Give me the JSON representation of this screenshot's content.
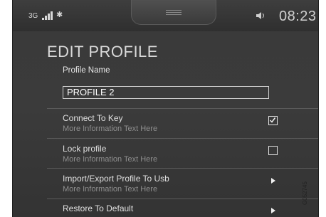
{
  "status": {
    "network": "3G",
    "bluetooth_icon": "bluetooth-icon",
    "volume_icon": "speaker-icon",
    "time": "08:23"
  },
  "page": {
    "title": "EDIT PROFILE"
  },
  "profile": {
    "label": "Profile Name",
    "value": "PROFILE 2"
  },
  "rows": [
    {
      "title": "Connect To Key",
      "info": "More Information Text Here",
      "control": "checkbox",
      "checked": true
    },
    {
      "title": "Lock profile",
      "info": "More Information Text Here",
      "control": "checkbox",
      "checked": false
    },
    {
      "title": "Import/Export Profile To Usb",
      "info": "More Information Text Here",
      "control": "arrow"
    },
    {
      "title": "Restore To Default",
      "control": "arrow"
    }
  ],
  "image_code": "G052745"
}
